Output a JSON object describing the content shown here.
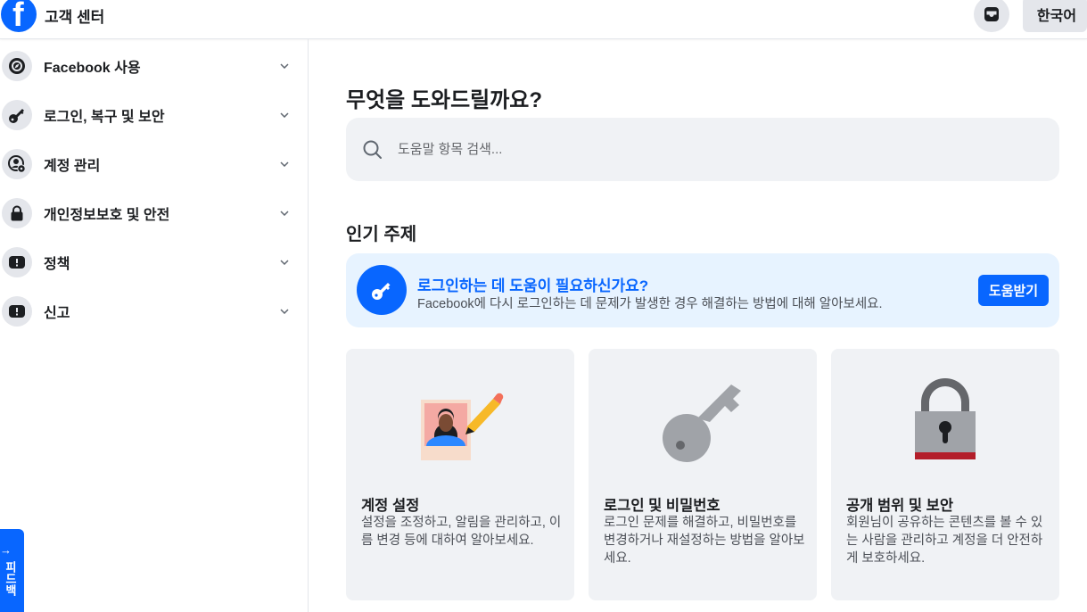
{
  "header": {
    "logo_letter": "f",
    "title": "고객 센터",
    "inbox_icon": "inbox-icon",
    "language": "한국어"
  },
  "sidebar": {
    "items": [
      {
        "label": "Facebook 사용",
        "icon": "compass-icon"
      },
      {
        "label": "로그인, 복구 및 보안",
        "icon": "key-icon"
      },
      {
        "label": "계정 관리",
        "icon": "account-gear-icon"
      },
      {
        "label": "개인정보보호 및 안전",
        "icon": "lock-icon"
      },
      {
        "label": "정책",
        "icon": "alert-icon"
      },
      {
        "label": "신고",
        "icon": "alert-icon"
      }
    ],
    "feedback": {
      "arrow": "→",
      "label": "피드백"
    }
  },
  "main": {
    "title": "무엇을 도와드릴까요?",
    "search": {
      "placeholder": "도움말 항목 검색..."
    },
    "popular_title": "인기 주제",
    "banner": {
      "title": "로그인하는 데 도움이 필요하신가요?",
      "description": "Facebook에 다시 로그인하는 데 문제가 발생한 경우 해결하는 방법에 대해 알아보세요.",
      "button": "도움받기"
    },
    "cards": [
      {
        "title": "계정 설정",
        "description": "설정을 조정하고, 알림을 관리하고, 이름 변경 등에 대하여 알아보세요."
      },
      {
        "title": "로그인 및 비밀번호",
        "description": "로그인 문제를 해결하고, 비밀번호를 변경하거나 재설정하는 방법을 알아보세요."
      },
      {
        "title": "공개 범위 및 보안",
        "description": "회원님이 공유하는 콘텐츠를 볼 수 있는 사람을 관리하고 계정을 더 안전하게 보호하세요."
      }
    ]
  },
  "colors": {
    "accent": "#0866ff",
    "banner_bg": "#e7f3ff",
    "card_bg": "#f0f2f5"
  }
}
